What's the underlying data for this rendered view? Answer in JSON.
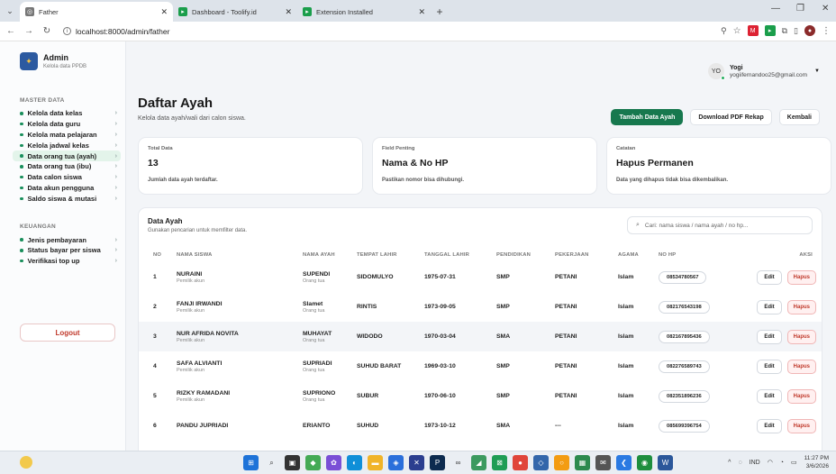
{
  "browser": {
    "tabs": [
      {
        "label": "Father",
        "active": true,
        "icon": "globe-icon"
      },
      {
        "label": "Dashboard - Toolify.id",
        "active": false,
        "icon": "toolify-icon"
      },
      {
        "label": "Extension Installed",
        "active": false,
        "icon": "toolify-icon"
      }
    ],
    "url": "localhost:8000/admin/father"
  },
  "sidebar": {
    "brand_title": "Admin",
    "brand_sub": "Kelola data PPDB",
    "section_master": "MASTER DATA",
    "master_items": [
      {
        "label": "Kelola data kelas"
      },
      {
        "label": "Kelola data guru"
      },
      {
        "label": "Kelola mata pelajaran"
      },
      {
        "label": "Kelola jadwal kelas"
      },
      {
        "label": "Data orang tua (ayah)"
      },
      {
        "label": "Data orang tua (ibu)"
      },
      {
        "label": "Data calon siswa"
      },
      {
        "label": "Data akun pengguna"
      },
      {
        "label": "Saldo siswa & mutasi"
      }
    ],
    "section_keuangan": "KEUANGAN",
    "keuangan_items": [
      {
        "label": "Jenis pembayaran"
      },
      {
        "label": "Status bayar per siswa"
      },
      {
        "label": "Verifikasi top up"
      }
    ],
    "logout_label": "Logout"
  },
  "user": {
    "initials": "YO",
    "name": "Yogi",
    "email": "yogiifernandoo25@gmail.com"
  },
  "page": {
    "title": "Daftar Ayah",
    "subtitle": "Kelola data ayah/wali dari calon siswa.",
    "btn_add": "Tambah Data Ayah",
    "btn_pdf": "Download PDF Rekap",
    "btn_back": "Kembali"
  },
  "cards": [
    {
      "label": "Total Data",
      "value": "13",
      "desc": "Jumlah data ayah terdaftar."
    },
    {
      "label": "Field Penting",
      "value": "Nama & No HP",
      "desc": "Pastikan nomor bisa dihubungi."
    },
    {
      "label": "Catatan",
      "value": "Hapus Permanen",
      "desc": "Data yang dihapus tidak bisa dikembalikan."
    }
  ],
  "table": {
    "title": "Data Ayah",
    "subtitle": "Gunakan pencarian untuk memfilter data.",
    "search_placeholder": "Cari: nama siswa / nama ayah / no hp...",
    "headers": {
      "no": "NO",
      "siswa": "NAMA SISWA",
      "ayah": "NAMA AYAH",
      "tempat": "TEMPAT LAHIR",
      "tanggal": "TANGGAL LAHIR",
      "pendidikan": "PENDIDIKAN",
      "pekerjaan": "PEKERJAAN",
      "agama": "AGAMA",
      "hp": "NO HP",
      "aksi": "AKSI"
    },
    "edit_label": "Edit",
    "delete_label": "Hapus",
    "rows": [
      {
        "no": "1",
        "siswa": "NURAINI",
        "siswa_sub": "Pemilik akun",
        "ayah": "SUPENDI",
        "ayah_sub": "Orang tua",
        "tempat": "SIDOMULYO",
        "tanggal": "1975-07-31",
        "pendidikan": "SMP",
        "pekerjaan": "PETANI",
        "agama": "Islam",
        "hp": "08534780567"
      },
      {
        "no": "2",
        "siswa": "FANJI IRWANDI",
        "siswa_sub": "Pemilik akun",
        "ayah": "Slamet",
        "ayah_sub": "Orang tua",
        "tempat": "RINTIS",
        "tanggal": "1973-09-05",
        "pendidikan": "SMP",
        "pekerjaan": "PETANI",
        "agama": "Islam",
        "hp": "082176543198"
      },
      {
        "no": "3",
        "siswa": "NUR AFRIDA NOVITA",
        "siswa_sub": "Pemilik akun",
        "ayah": "MUHAYAT",
        "ayah_sub": "Orang tua",
        "tempat": "WIDODO",
        "tanggal": "1970-03-04",
        "pendidikan": "SMA",
        "pekerjaan": "PETANI",
        "agama": "Islam",
        "hp": "082167895436"
      },
      {
        "no": "4",
        "siswa": "SAFA ALVIANTI",
        "siswa_sub": "Pemilik akun",
        "ayah": "SUPRIADI",
        "ayah_sub": "Orang tua",
        "tempat": "SUHUD BARAT",
        "tanggal": "1969-03-10",
        "pendidikan": "SMP",
        "pekerjaan": "PETANI",
        "agama": "Islam",
        "hp": "082276589743"
      },
      {
        "no": "5",
        "siswa": "RIZKY RAMADANI",
        "siswa_sub": "Pemilik akun",
        "ayah": "SUPRIONO",
        "ayah_sub": "Orang tua",
        "tempat": "SUBUR",
        "tanggal": "1970-06-10",
        "pendidikan": "SMP",
        "pekerjaan": "PETANI",
        "agama": "Islam",
        "hp": "082351896236"
      },
      {
        "no": "6",
        "siswa": "PANDU JUPRIADI",
        "siswa_sub": "",
        "ayah": "ERIANTO",
        "ayah_sub": "",
        "tempat": "SUHUD",
        "tanggal": "1973-10-12",
        "pendidikan": "SMA",
        "pekerjaan": "---",
        "agama": "Islam",
        "hp": "085699396754"
      }
    ]
  },
  "taskbar": {
    "lang": "IND",
    "time": "11:27 PM",
    "date": "3/6/2026"
  },
  "colors": {
    "accent": "#17784e",
    "danger": "#c0392b",
    "active_bg": "#e3f4ea"
  }
}
